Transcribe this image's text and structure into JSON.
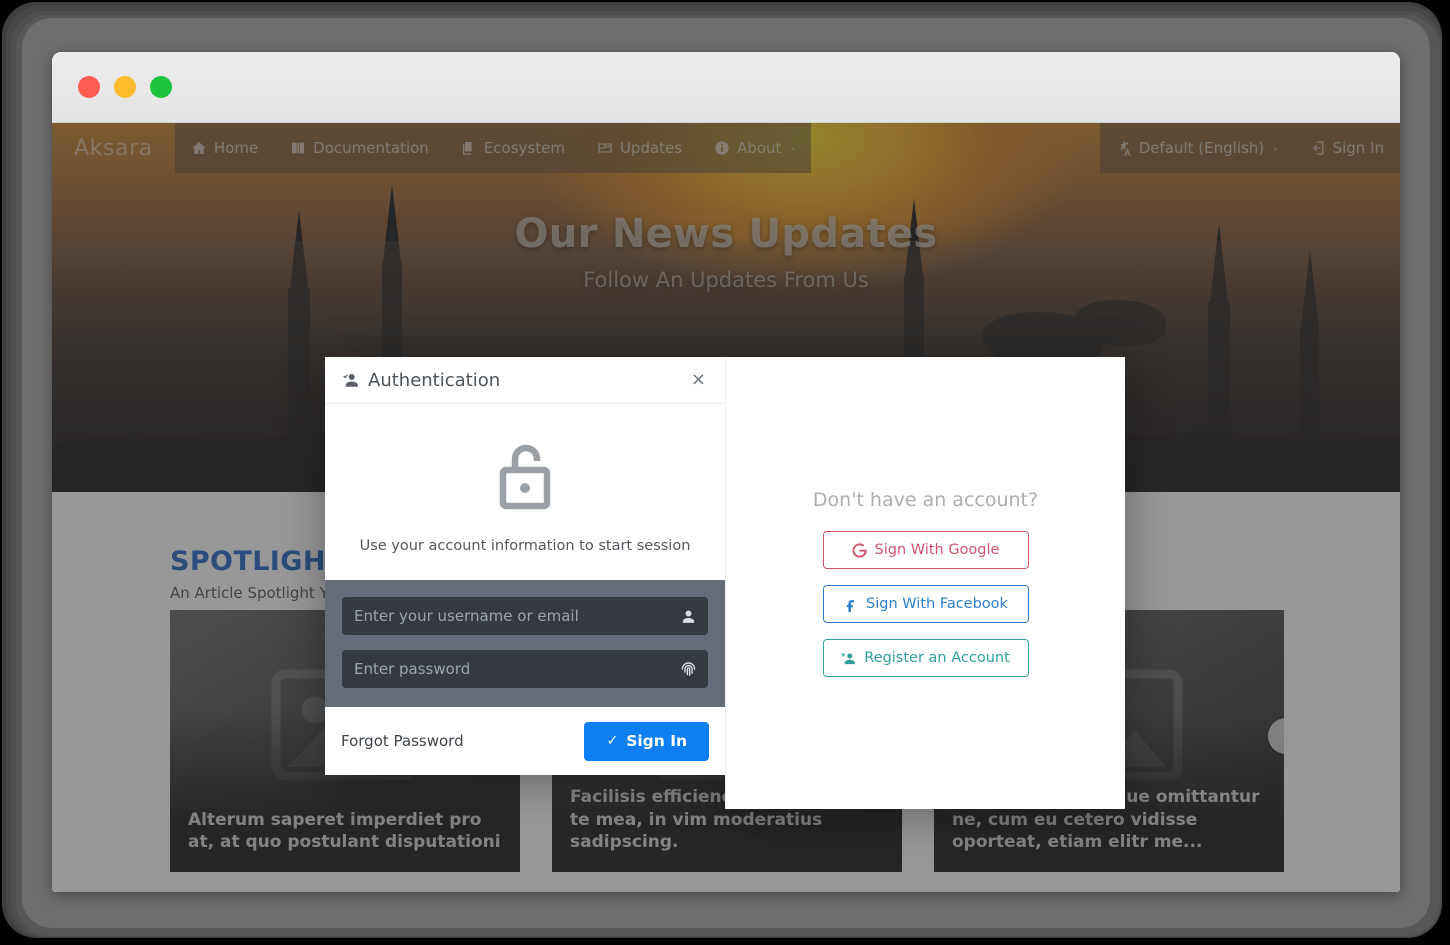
{
  "window": {
    "traffic_lights": [
      "close",
      "minimize",
      "maximize"
    ]
  },
  "navbar": {
    "brand": "Aksara",
    "items": [
      {
        "label": "Home",
        "icon": "home-icon",
        "caret": ""
      },
      {
        "label": "Documentation",
        "icon": "book-icon",
        "caret": ""
      },
      {
        "label": "Ecosystem",
        "icon": "layers-icon",
        "caret": ""
      },
      {
        "label": "Updates",
        "icon": "newspaper-icon",
        "caret": ""
      },
      {
        "label": "About",
        "icon": "info-circle-icon",
        "caret": "›"
      }
    ],
    "language": {
      "label": "Default (English)",
      "icon": "translate-icon",
      "caret": "›"
    },
    "signin": {
      "label": "Sign In",
      "icon": "login-icon"
    }
  },
  "hero": {
    "title": "Our News Updates",
    "subtitle": "Follow An Updates From Us"
  },
  "spotlight": {
    "title": "SPOTLIGHT",
    "subtitle": "An Article Spotlight Yo",
    "accent_color": "#1b5fbe",
    "cards": [
      {
        "title": "Alterum saperet imperdiet pro at, at quo postulant disputationi"
      },
      {
        "title": "Facilisis efficiendi consectetuer te mea, in vim moderatius sadipscing."
      },
      {
        "title": "Eum munere oblique omittantur ne, cum eu cetero vidisse oporteat, etiam elitr me..."
      }
    ],
    "next_arrow": "›"
  },
  "modal": {
    "title": "Authentication",
    "title_icon": "user-check-icon",
    "close_label": "×",
    "lock_icon": "unlocked-padlock-icon",
    "description": "Use your account information to start session",
    "fields": {
      "username": {
        "placeholder": "Enter your username or email",
        "value": "",
        "icon": "person-icon"
      },
      "password": {
        "placeholder": "Enter password",
        "value": "",
        "icon": "fingerprint-icon"
      }
    },
    "footer": {
      "forgot_label": "Forgot Password",
      "signin_label": "Sign In",
      "signin_check": "✓",
      "signin_color": "#0d7ff2"
    },
    "register_panel": {
      "heading": "Don't have an account?",
      "buttons": [
        {
          "label": "Sign With Google",
          "icon": "google-g-icon",
          "color": "#d0536a"
        },
        {
          "label": "Sign With Facebook",
          "icon": "facebook-f-icon",
          "color": "#2f7fd0"
        },
        {
          "label": "Register an Account",
          "icon": "user-plus-icon",
          "color": "#2f9e9e"
        }
      ]
    }
  }
}
